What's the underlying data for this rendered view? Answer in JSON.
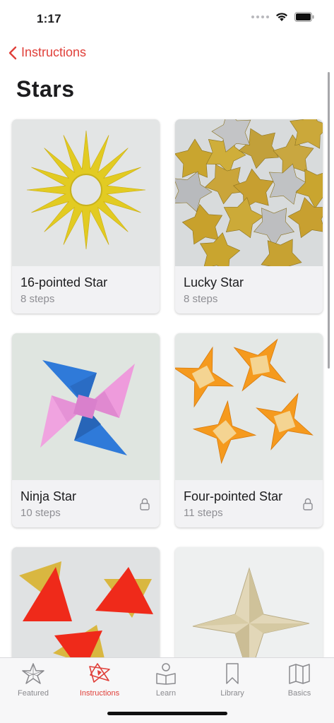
{
  "status": {
    "time": "1:17"
  },
  "nav": {
    "back_label": "Instructions",
    "title": "Stars"
  },
  "colors": {
    "accent": "#e0403a",
    "secondary_text": "#8e8e93",
    "card_bg": "#f2f2f4"
  },
  "cards": [
    {
      "name": "16-pointed Star",
      "steps": "8 steps",
      "locked": false,
      "image": "yellow-sixteen-point-star"
    },
    {
      "name": "Lucky Star",
      "steps": "8 steps",
      "locked": false,
      "image": "gold-silver-lucky-stars"
    },
    {
      "name": "Ninja Star",
      "steps": "10 steps",
      "locked": true,
      "image": "blue-pink-ninja-star"
    },
    {
      "name": "Four-pointed Star",
      "steps": "11 steps",
      "locked": true,
      "image": "orange-four-point-stars"
    },
    {
      "name": "",
      "steps": "",
      "locked": false,
      "image": "red-gold-triangle-stars"
    },
    {
      "name": "",
      "steps": "",
      "locked": false,
      "image": "paper-four-point-star"
    }
  ],
  "tabs": [
    {
      "label": "Featured",
      "icon": "star-outline-icon",
      "active": false
    },
    {
      "label": "Instructions",
      "icon": "origami-star-icon",
      "active": true
    },
    {
      "label": "Learn",
      "icon": "person-book-icon",
      "active": false
    },
    {
      "label": "Library",
      "icon": "bookmark-icon",
      "active": false
    },
    {
      "label": "Basics",
      "icon": "map-icon",
      "active": false
    }
  ]
}
